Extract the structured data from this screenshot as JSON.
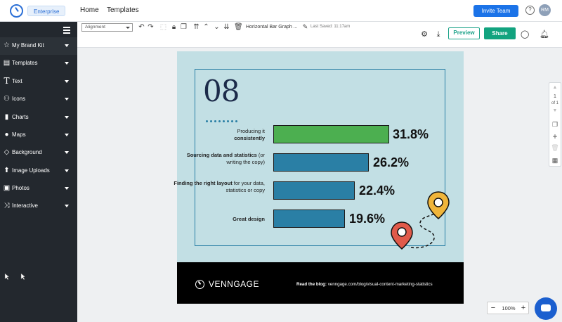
{
  "topnav": {
    "badge": "Enterprise",
    "home": "Home",
    "templates": "Templates",
    "invite": "Invite Team",
    "help": "?",
    "avatar": "RM"
  },
  "sidebar": {
    "items": [
      {
        "label": "My Brand Kit",
        "icon": "star-icon"
      },
      {
        "label": "Templates",
        "icon": "templates-icon"
      },
      {
        "label": "Text",
        "icon": "text-icon"
      },
      {
        "label": "Icons",
        "icon": "icons-icon"
      },
      {
        "label": "Charts",
        "icon": "charts-icon"
      },
      {
        "label": "Maps",
        "icon": "globe-icon"
      },
      {
        "label": "Background",
        "icon": "bucket-icon"
      },
      {
        "label": "Image Uploads",
        "icon": "upload-icon"
      },
      {
        "label": "Photos",
        "icon": "photo-icon"
      },
      {
        "label": "Interactive",
        "icon": "shuffle-icon"
      }
    ]
  },
  "toolbar": {
    "alignment": "Alignment",
    "doc_title": "Horizontal Bar Graph ...",
    "saved": "Last Saved: 11:17am",
    "preview": "Preview",
    "share": "Share"
  },
  "canvas": {
    "number": "08",
    "rows": [
      {
        "label_plain_1": "Producing it",
        "label_bold": "consistently",
        "label_plain_2": "",
        "value": "31.8%",
        "pct": 31.8,
        "color": "#4caf50"
      },
      {
        "label_bold": "Sourcing data and statistics",
        "label_plain": " (or writing the copy)",
        "value": "26.2%",
        "pct": 26.2,
        "color": "#2a7fa5"
      },
      {
        "label_bold": "Finding the right layout",
        "label_plain": " for your data, statistics or copy",
        "value": "22.4%",
        "pct": 22.4,
        "color": "#2a7fa5"
      },
      {
        "label_bold": "Great design",
        "label_plain": "",
        "value": "19.6%",
        "pct": 19.6,
        "color": "#2a7fa5"
      }
    ],
    "footer_brand": "VENNGAGE",
    "blog_bold": "Read the blog:",
    "blog_url": " venngage.com/blog/visual-content-marketing-statistics"
  },
  "rpanel": {
    "page": "1",
    "of": "of 1"
  },
  "zoom": {
    "minus": "−",
    "value": "100%",
    "plus": "+"
  }
}
